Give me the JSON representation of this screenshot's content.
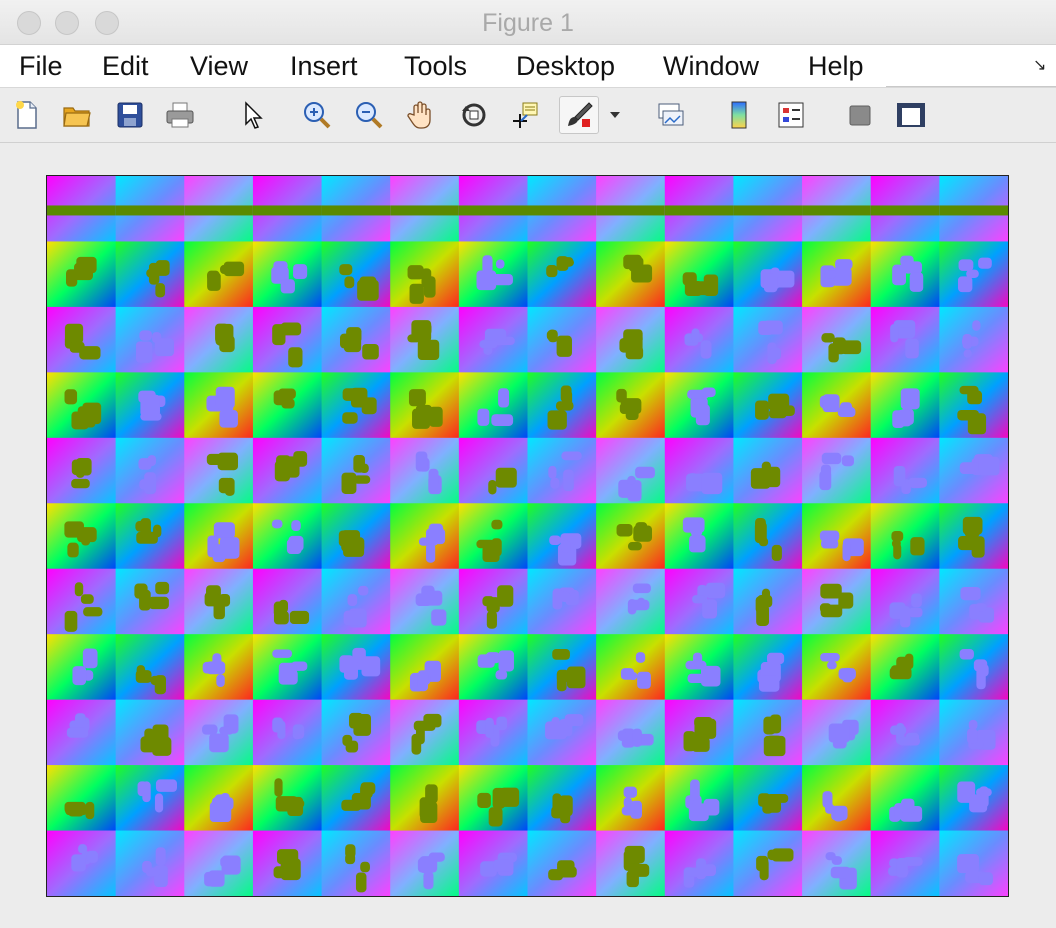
{
  "window": {
    "title": "Figure 1"
  },
  "menubar": {
    "items": [
      "File",
      "Edit",
      "View",
      "Insert",
      "Tools",
      "Desktop",
      "Window",
      "Help"
    ]
  },
  "toolbar": {
    "buttons": [
      "new-figure-icon",
      "open-file-icon",
      "save-icon",
      "print-icon",
      "edit-plot-arrow-icon",
      "zoom-in-icon",
      "zoom-out-icon",
      "pan-hand-icon",
      "rotate-3d-icon",
      "data-cursor-icon",
      "brush-icon",
      "link-plot-icon",
      "colorbar-icon",
      "legend-icon",
      "hide-plot-tools-icon",
      "show-plot-tools-icon"
    ]
  },
  "image": {
    "description_colors": [
      "#ff00ff",
      "#00ff00",
      "#0000ff",
      "#ff0000",
      "#00ffff",
      "#ffff00"
    ],
    "grid_cols": 14,
    "grid_rows": 11
  }
}
